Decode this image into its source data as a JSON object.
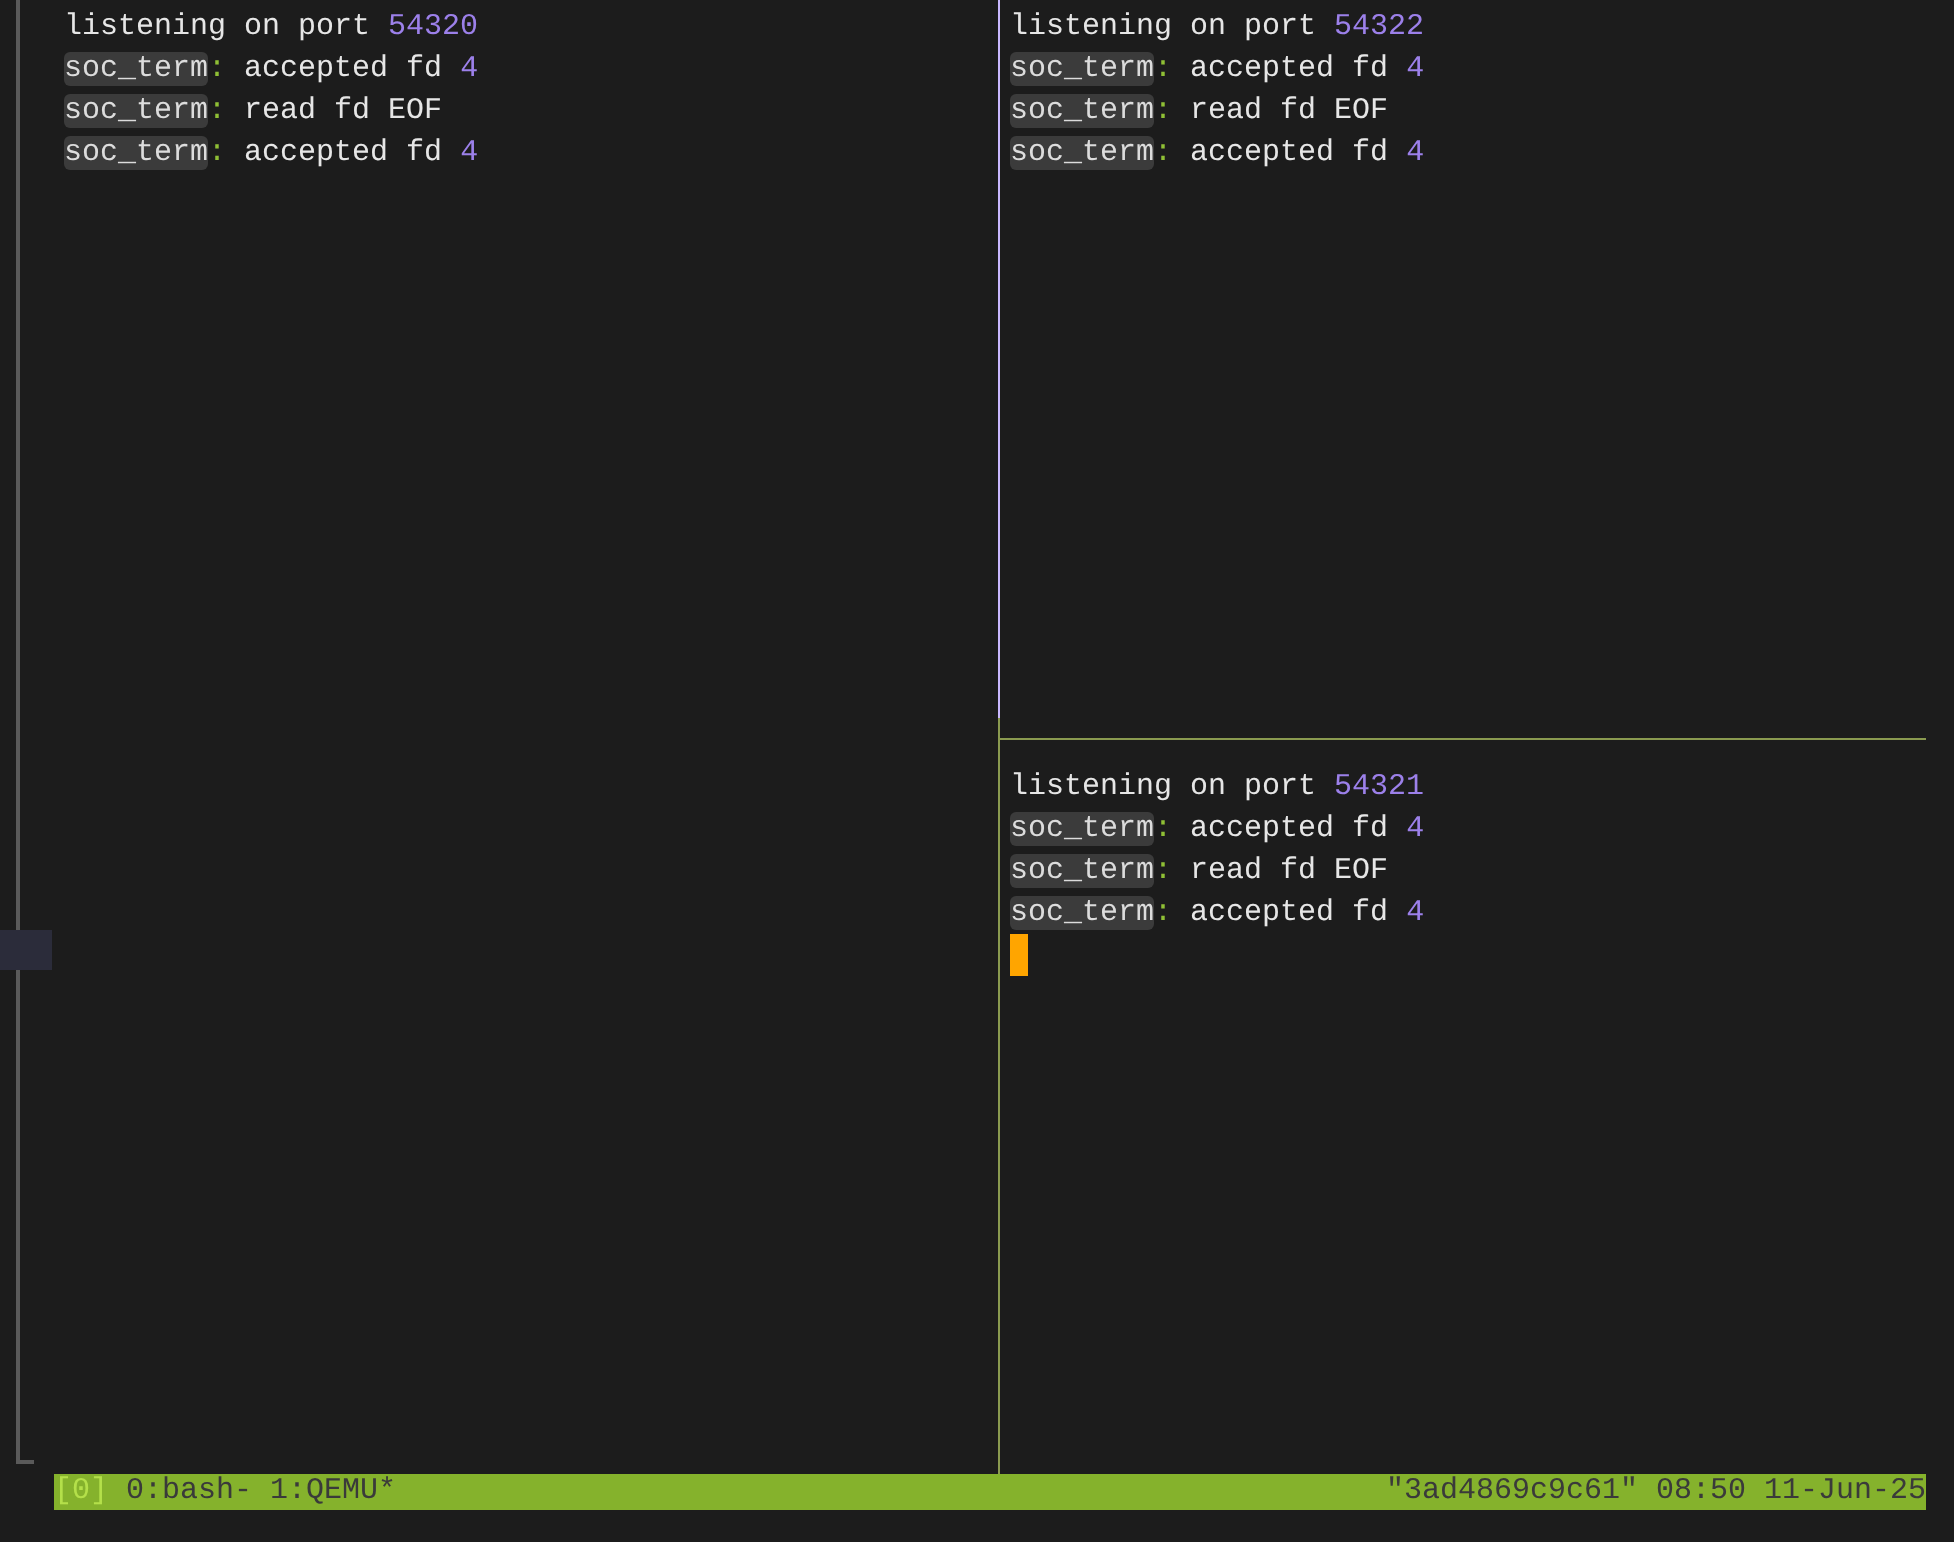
{
  "panes": [
    {
      "active": false,
      "cursor": false,
      "lines": [
        {
          "segments": [
            {
              "kind": "plain",
              "text": "listening on port"
            },
            {
              "kind": "number",
              "text": "54320"
            }
          ]
        },
        {
          "segments": [
            {
              "kind": "tag",
              "text": "soc_term"
            },
            {
              "kind": "sep",
              "text": ":"
            },
            {
              "kind": "plain",
              "text": "accepted fd"
            },
            {
              "kind": "number",
              "text": "4"
            }
          ]
        },
        {
          "segments": [
            {
              "kind": "tag",
              "text": "soc_term"
            },
            {
              "kind": "sep",
              "text": ":"
            },
            {
              "kind": "plain",
              "text": "read fd EOF"
            }
          ]
        },
        {
          "segments": [
            {
              "kind": "tag",
              "text": "soc_term"
            },
            {
              "kind": "sep",
              "text": ":"
            },
            {
              "kind": "plain",
              "text": "accepted fd"
            },
            {
              "kind": "number",
              "text": "4"
            }
          ]
        }
      ]
    },
    {
      "active": false,
      "cursor": false,
      "lines": [
        {
          "segments": [
            {
              "kind": "plain",
              "text": "listening on port"
            },
            {
              "kind": "number",
              "text": "54322"
            }
          ]
        },
        {
          "segments": [
            {
              "kind": "tag",
              "text": "soc_term"
            },
            {
              "kind": "sep",
              "text": ":"
            },
            {
              "kind": "plain",
              "text": "accepted fd"
            },
            {
              "kind": "number",
              "text": "4"
            }
          ]
        },
        {
          "segments": [
            {
              "kind": "tag",
              "text": "soc_term"
            },
            {
              "kind": "sep",
              "text": ":"
            },
            {
              "kind": "plain",
              "text": "read fd EOF"
            }
          ]
        },
        {
          "segments": [
            {
              "kind": "tag",
              "text": "soc_term"
            },
            {
              "kind": "sep",
              "text": ":"
            },
            {
              "kind": "plain",
              "text": "accepted fd"
            },
            {
              "kind": "number",
              "text": "4"
            }
          ]
        }
      ]
    },
    {
      "active": true,
      "cursor": true,
      "lines": [
        {
          "segments": [
            {
              "kind": "plain",
              "text": "listening on port"
            },
            {
              "kind": "number",
              "text": "54321"
            }
          ]
        },
        {
          "segments": [
            {
              "kind": "tag",
              "text": "soc_term"
            },
            {
              "kind": "sep",
              "text": ":"
            },
            {
              "kind": "plain",
              "text": "accepted fd"
            },
            {
              "kind": "number",
              "text": "4"
            }
          ]
        },
        {
          "segments": [
            {
              "kind": "tag",
              "text": "soc_term"
            },
            {
              "kind": "sep",
              "text": ":"
            },
            {
              "kind": "plain",
              "text": "read fd EOF"
            }
          ]
        },
        {
          "segments": [
            {
              "kind": "tag",
              "text": "soc_term"
            },
            {
              "kind": "sep",
              "text": ":"
            },
            {
              "kind": "plain",
              "text": "accepted fd"
            },
            {
              "kind": "number",
              "text": "4"
            }
          ]
        }
      ]
    }
  ],
  "status_bar": {
    "session": "[0]",
    "windows": [
      "0:bash-",
      "1:QEMU*"
    ],
    "right": [
      "\"3ad4869c9c61\"",
      "08:50",
      "11-Jun-25"
    ]
  }
}
